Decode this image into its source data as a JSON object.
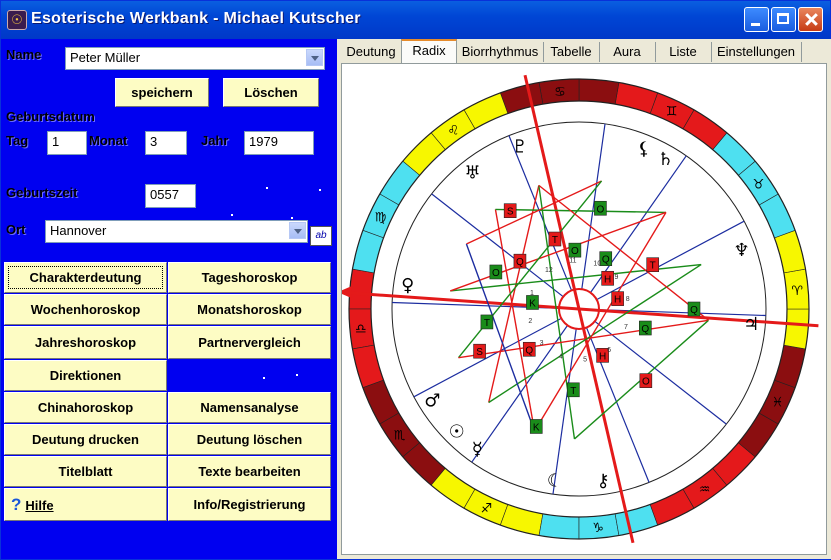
{
  "window": {
    "title": "Esoterische Werkbank - Michael Kutscher",
    "app_icon": "astrology-app-icon"
  },
  "form": {
    "name_label": "Name",
    "name_value": "Peter Müller",
    "save_label": "speichern",
    "delete_label": "Löschen",
    "birthdate_label": "Geburtsdatum",
    "day_label": "Tag",
    "day_value": "1",
    "month_label": "Monat",
    "month_value": "3",
    "year_label": "Jahr",
    "year_value": "1979",
    "birthtime_label": "Geburtszeit",
    "birthtime_value": "0557",
    "place_label": "Ort",
    "place_value": "Hannover",
    "ab_label": "ab"
  },
  "buttons": {
    "charakterdeutung": "Charakterdeutung",
    "tageshoroskop": "Tageshoroskop",
    "wochenhoroskop": "Wochenhoroskop",
    "monatshoroskop": "Monatshoroskop",
    "jahreshoroskop": "Jahreshoroskop",
    "partnervergleich": "Partnervergleich",
    "direktionen": "Direktionen",
    "chinahoroskop": "Chinahoroskop",
    "namensanalyse": "Namensanalyse",
    "deutung_drucken": "Deutung drucken",
    "deutung_loeschen": "Deutung löschen",
    "titelblatt": "Titelblatt",
    "texte_bearbeiten": "Texte bearbeiten",
    "hilfe": "Hilfe",
    "info": "Info/Registrierung"
  },
  "tabs": [
    "Deutung",
    "Radix",
    "Biorrhythmus",
    "Tabelle",
    "Aura",
    "Liste",
    "Einstellungen"
  ],
  "active_tab": "Radix",
  "chart": {
    "house_labels": [
      "2",
      "3",
      "4",
      "5",
      "6",
      "7",
      "8",
      "9",
      "10",
      "11",
      "12",
      "1"
    ],
    "aspect_letters": [
      "H",
      "Q",
      "T",
      "O",
      "S",
      "K",
      "H",
      "Q",
      "T",
      "O",
      "S",
      "K",
      "Q",
      "T",
      "O",
      "Q",
      "H",
      "O",
      "Q",
      "T"
    ],
    "colors": {
      "fire": "#e4191b",
      "earth": "#8b0e10",
      "air": "#f7f700",
      "water": "#4ee0f0",
      "aspect_hard": "#e41a1a",
      "aspect_soft": "#1a8c1a",
      "aspect_neutral": "#1c2da0"
    }
  }
}
